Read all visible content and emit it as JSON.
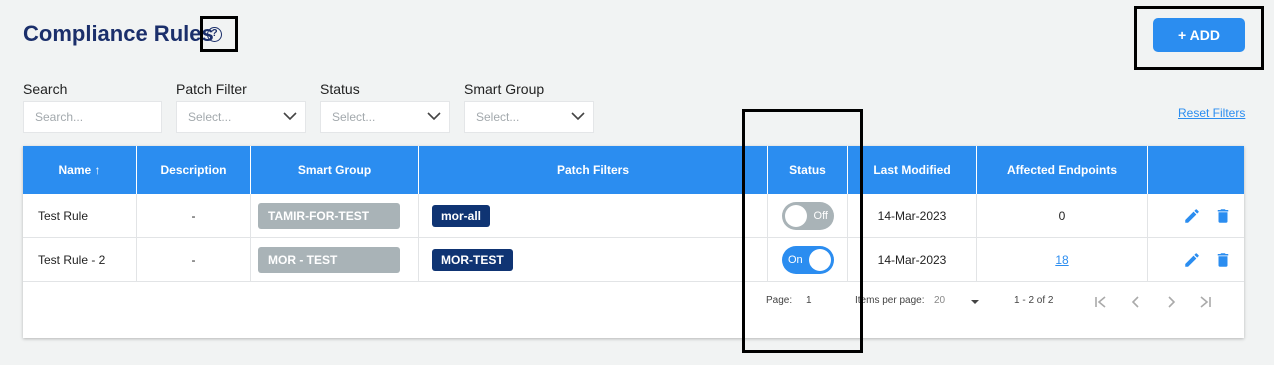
{
  "page": {
    "title": "Compliance Rules",
    "add_label": "+ ADD",
    "help_icon": "?"
  },
  "filters": {
    "search_label": "Search",
    "search_placeholder": "Search...",
    "patch_label": "Patch Filter",
    "patch_value": "Select...",
    "status_label": "Status",
    "status_value": "Select...",
    "group_label": "Smart Group",
    "group_value": "Select...",
    "reset_label": "Reset Filters"
  },
  "table": {
    "headers": {
      "name": "Name",
      "sort_icon": "↑",
      "description": "Description",
      "smart_group": "Smart Group",
      "patch_filters": "Patch Filters",
      "status": "Status",
      "last_modified": "Last Modified",
      "affected": "Affected Endpoints"
    },
    "rows": [
      {
        "name": "Test Rule",
        "description": "-",
        "smart_group": "TAMIR-FOR-TEST",
        "patch_filter": "mor-all",
        "status": "Off",
        "last_modified": "14-Mar-2023",
        "affected": "0"
      },
      {
        "name": "Test Rule - 2",
        "description": "-",
        "smart_group": "MOR - TEST",
        "patch_filter": "MOR-TEST",
        "status": "On",
        "last_modified": "14-Mar-2023",
        "affected": "18"
      }
    ]
  },
  "pagination": {
    "page_label": "Page:",
    "page_value": "1",
    "items_label": "Items per page:",
    "items_value": "20",
    "range": "1 - 2 of 2"
  },
  "colors": {
    "primary": "#2b8df0",
    "title": "#1b2f6b",
    "navy_chip": "#0f3473",
    "grey_chip": "#a9b3b7"
  }
}
